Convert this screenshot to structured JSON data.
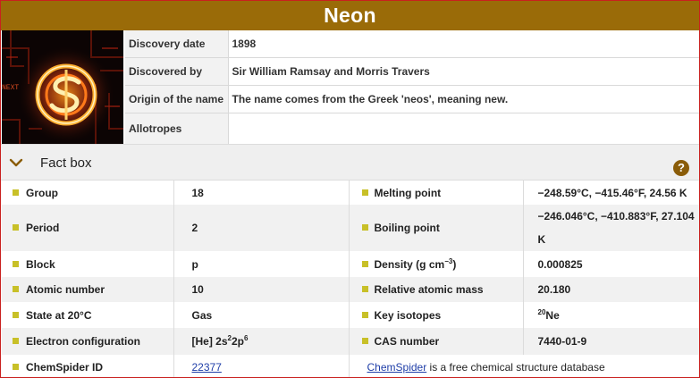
{
  "element": {
    "name": "Neon"
  },
  "hero_image": {
    "alt": "neon-sign-image"
  },
  "info": [
    {
      "label": "Discovery date",
      "value": "1898"
    },
    {
      "label": "Discovered by",
      "value": "Sir William Ramsay and Morris Travers"
    },
    {
      "label": "Origin of the name",
      "value": "The name comes from the Greek 'neos', meaning new."
    },
    {
      "label": "Allotropes",
      "value": ""
    }
  ],
  "factbox": {
    "title": "Fact box",
    "help_label": "?"
  },
  "facts": {
    "group": {
      "label": "Group",
      "value": "18"
    },
    "melting_point": {
      "label": "Melting point",
      "value": "−248.59°C, −415.46°F, 24.56 K"
    },
    "period": {
      "label": "Period",
      "value": "2"
    },
    "boiling_point": {
      "label": "Boiling point",
      "value": "−246.046°C, −410.883°F, 27.104 K"
    },
    "block": {
      "label": "Block",
      "value": "p"
    },
    "density": {
      "label_prefix": "Density (g cm",
      "label_exp": "−3",
      "label_suffix": ")",
      "value": "0.000825"
    },
    "atomic_number": {
      "label": "Atomic number",
      "value": "10"
    },
    "relative_atomic_mass": {
      "label": "Relative atomic mass",
      "value": "20.180"
    },
    "state": {
      "label": "State at 20°C",
      "value": "Gas"
    },
    "key_isotopes": {
      "label": "Key isotopes",
      "mass": "20",
      "symbol": "Ne"
    },
    "electron_configuration": {
      "label": "Electron configuration",
      "core": "[He] 2s",
      "exp1": "2",
      "mid": "2p",
      "exp2": "6"
    },
    "cas_number": {
      "label": "CAS number",
      "value": "7440-01-9"
    },
    "chemspider": {
      "label": "ChemSpider ID",
      "id": "22377",
      "link_text": "ChemSpider",
      "note": " is a free chemical structure database"
    }
  },
  "colors": {
    "title_bar": "#9a6b08",
    "bullet": "#c8c028",
    "help": "#8a5c08",
    "link": "#1f3ea8",
    "border": "#c9201e"
  }
}
